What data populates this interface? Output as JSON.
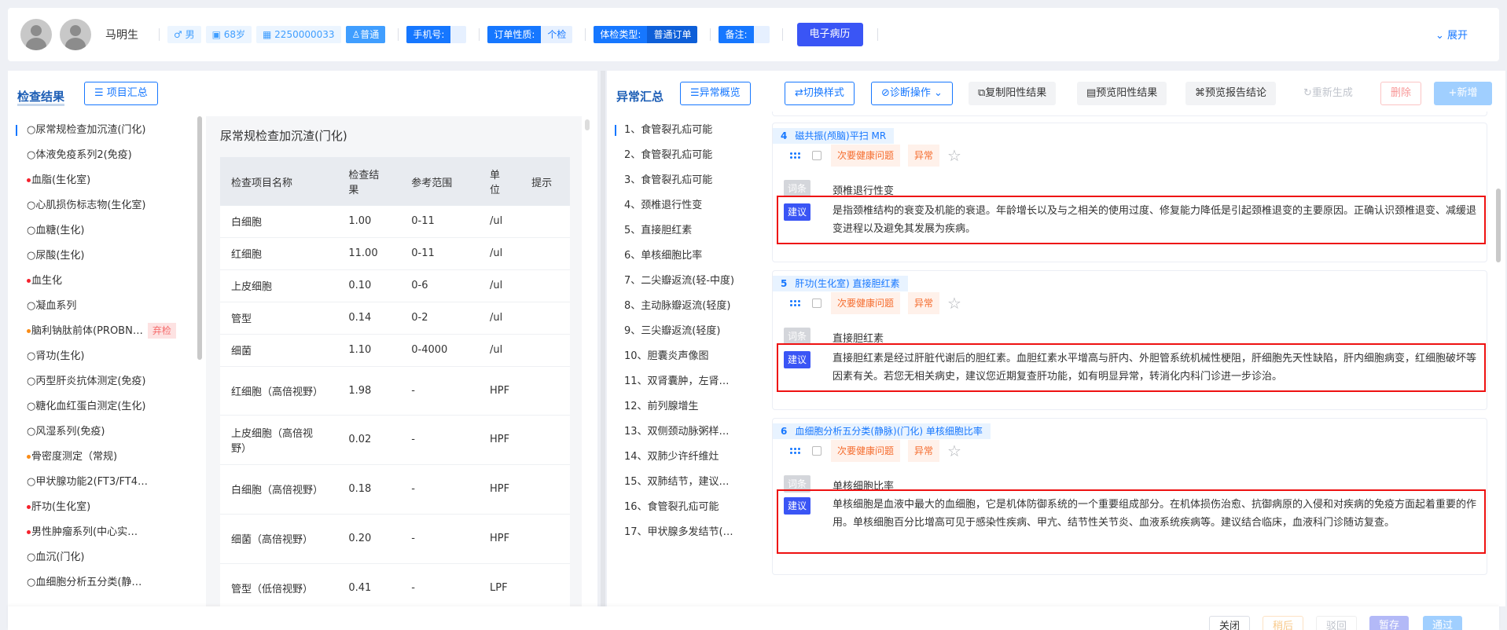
{
  "header": {
    "name": "马明生",
    "gender": "♂ 男",
    "age": "68岁",
    "id": "2250000033",
    "level": "普通",
    "phone_label": "手机号:",
    "phone_value": "",
    "order_label": "订单性质:",
    "order_value": "个检",
    "exam_type_label": "体检类型:",
    "exam_type_value": "普通订单",
    "note_label": "备注:",
    "note_value": "",
    "emr_button": "电子病历",
    "expand_label": "展开"
  },
  "left": {
    "title": "检查结果",
    "summary_button": "项目汇总",
    "categories": [
      {
        "label": "○尿常规检查加沉渣(门化)",
        "dot": ""
      },
      {
        "label": "○体液免疫系列2(免疫)",
        "dot": ""
      },
      {
        "label": "血脂(生化室)",
        "dot": "red"
      },
      {
        "label": "○心肌损伤标志物(生化室)",
        "dot": ""
      },
      {
        "label": "○血糖(生化)",
        "dot": ""
      },
      {
        "label": "○尿酸(生化)",
        "dot": ""
      },
      {
        "label": "血生化",
        "dot": "red"
      },
      {
        "label": "○凝血系列",
        "dot": ""
      },
      {
        "label": "脑利钠肽前体(PROBN…",
        "dot": "orange",
        "badge": "弃检"
      },
      {
        "label": "○肾功(生化)",
        "dot": ""
      },
      {
        "label": "○丙型肝炎抗体测定(免疫)",
        "dot": ""
      },
      {
        "label": "○糖化血红蛋白测定(生化)",
        "dot": ""
      },
      {
        "label": "○风湿系列(免疫)",
        "dot": ""
      },
      {
        "label": "骨密度测定（常规)",
        "dot": "orange"
      },
      {
        "label": "○甲状腺功能2(FT3/FT4…",
        "dot": ""
      },
      {
        "label": "肝功(生化室)",
        "dot": "red"
      },
      {
        "label": "男性肿瘤系列(中心实…",
        "dot": "red"
      },
      {
        "label": "○血沉(门化)",
        "dot": ""
      },
      {
        "label": "○血细胞分析五分类(静…",
        "dot": ""
      }
    ],
    "detail_title": "尿常规检查加沉渣(门化)",
    "table_headers": [
      "检查项目名称",
      "检查结果",
      "参考范围",
      "单位",
      "提示"
    ],
    "rows": [
      {
        "name": "白细胞",
        "result": "1.00",
        "range": "0-11",
        "unit": "/ul",
        "hint": ""
      },
      {
        "name": "红细胞",
        "result": "11.00",
        "range": "0-11",
        "unit": "/ul",
        "hint": ""
      },
      {
        "name": "上皮细胞",
        "result": "0.10",
        "range": "0-6",
        "unit": "/ul",
        "hint": ""
      },
      {
        "name": "管型",
        "result": "0.14",
        "range": "0-2",
        "unit": "/ul",
        "hint": ""
      },
      {
        "name": "细菌",
        "result": "1.10",
        "range": "0-4000",
        "unit": "/ul",
        "hint": ""
      },
      {
        "name": "红细胞（高倍视野）",
        "result": "1.98",
        "range": "-",
        "unit": "HPF",
        "hint": ""
      },
      {
        "name": "上皮细胞（高倍视野）",
        "result": "0.02",
        "range": "-",
        "unit": "HPF",
        "hint": ""
      },
      {
        "name": "白细胞（高倍视野）",
        "result": "0.18",
        "range": "-",
        "unit": "HPF",
        "hint": ""
      },
      {
        "name": "细菌（高倍视野）",
        "result": "0.20",
        "range": "-",
        "unit": "HPF",
        "hint": ""
      },
      {
        "name": "管型（低倍视野）",
        "result": "0.41",
        "range": "-",
        "unit": "LPF",
        "hint": ""
      }
    ]
  },
  "right": {
    "title": "异常汇总",
    "overview_button": "异常概览",
    "toolbar": {
      "switch_style": "⇄切换样式",
      "diag_ops": "诊断操作",
      "copy_pos": "复制阳性结果",
      "preview_pos": "预览阳性结果",
      "preview_report": "预览报告结论",
      "regenerate": "重新生成",
      "delete": "删除",
      "add": "+新增"
    },
    "abnormal_list": [
      "1、食管裂孔疝可能",
      "2、食管裂孔疝可能",
      "3、食管裂孔疝可能",
      "4、颈椎退行性变",
      "5、直接胆红素",
      "6、单核细胞比率",
      "7、二尖瓣返流(轻-中度)",
      "8、主动脉瓣返流(轻度)",
      "9、三尖瓣返流(轻度)",
      "10、胆囊炎声像图",
      "11、双肾囊肿，左肾…",
      "12、前列腺增生",
      "13、双侧颈动脉粥样…",
      "14、双肺少许纤维灶",
      "15、双肺结节，建议…",
      "16、食管裂孔疝可能",
      "17、甲状腺多发结节(…"
    ],
    "cards": [
      {
        "num": "4",
        "source": "磁共振(颅脑)平扫 MR",
        "tag_minor": "次要健康问题",
        "tag_abn": "异常",
        "term_label": "词条",
        "term": "颈椎退行性变",
        "sugg_label": "建议",
        "sugg": "是指颈椎结构的衰变及机能的衰退。年龄增长以及与之相关的使用过度、修复能力降低是引起颈椎退变的主要原因。正确认识颈椎退变、减缓退变进程以及避免其发展为疾病。"
      },
      {
        "num": "5",
        "source": "肝功(生化室) 直接胆红素",
        "tag_minor": "次要健康问题",
        "tag_abn": "异常",
        "term_label": "词条",
        "term": "直接胆红素",
        "sugg_label": "建议",
        "sugg": "直接胆红素是经过肝脏代谢后的胆红素。血胆红素水平增高与肝内、外胆管系统机械性梗阻，肝细胞先天性缺陷，肝内细胞病变，红细胞破坏等因素有关。若您无相关病史，建议您近期复查肝功能，如有明显异常，转消化内科门诊进一步诊治。"
      },
      {
        "num": "6",
        "source": "血细胞分析五分类(静脉)(门化) 单核细胞比率",
        "tag_minor": "次要健康问题",
        "tag_abn": "异常",
        "term_label": "词条",
        "term": "单核细胞比率",
        "sugg_label": "建议",
        "sugg": "单核细胞是血液中最大的血细胞，它是机体防御系统的一个重要组成部分。在机体损伤治愈、抗御病原的入侵和对疾病的免疫方面起着重要的作用。单核细胞百分比增高可见于感染性疾病、甲亢、结节性关节炎、血液系统疾病等。建议结合临床，血液科门诊随访复查。"
      }
    ]
  },
  "footer": {
    "close": "关闭",
    "hold": "稍后",
    "reject": "驳回",
    "save": "暂存",
    "pass": "通过"
  },
  "colors": {
    "primary": "#1677ff",
    "emr": "#3a55f5",
    "highlight_box": "#e11111"
  }
}
